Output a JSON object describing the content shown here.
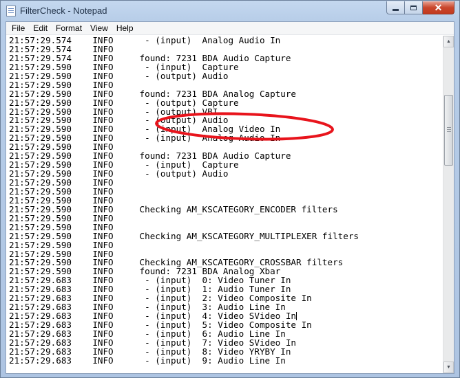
{
  "window": {
    "title": "FilterCheck - Notepad",
    "close_glyph": "✕"
  },
  "menu": [
    "File",
    "Edit",
    "Format",
    "View",
    "Help"
  ],
  "annotation": {
    "color": "#e8141c",
    "shape": "ellipse"
  },
  "lines": [
    "21:57:29.574    INFO      - (input)  Analog Audio In",
    "21:57:29.574    INFO",
    "21:57:29.574    INFO     found: 7231 BDA Audio Capture",
    "21:57:29.590    INFO      - (input)  Capture",
    "21:57:29.590    INFO      - (output) Audio",
    "21:57:29.590    INFO",
    "21:57:29.590    INFO     found: 7231 BDA Analog Capture",
    "21:57:29.590    INFO      - (output) Capture",
    "21:57:29.590    INFO      - (output) VBI",
    "21:57:29.590    INFO      - (output) Audio",
    "21:57:29.590    INFO      - (input)  Analog Video In",
    "21:57:29.590    INFO      - (input)  Analog Audio In",
    "21:57:29.590    INFO",
    "21:57:29.590    INFO     found: 7231 BDA Audio Capture",
    "21:57:29.590    INFO      - (input)  Capture",
    "21:57:29.590    INFO      - (output) Audio",
    "21:57:29.590    INFO",
    "21:57:29.590    INFO",
    "21:57:29.590    INFO",
    "21:57:29.590    INFO     Checking AM_KSCATEGORY_ENCODER filters",
    "21:57:29.590    INFO",
    "21:57:29.590    INFO",
    "21:57:29.590    INFO     Checking AM_KSCATEGORY_MULTIPLEXER filters",
    "21:57:29.590    INFO",
    "21:57:29.590    INFO",
    "21:57:29.590    INFO     Checking AM_KSCATEGORY_CROSSBAR filters",
    "21:57:29.590    INFO     found: 7231 BDA Analog Xbar",
    "21:57:29.683    INFO      - (input)  0: Video Tuner In",
    "21:57:29.683    INFO      - (input)  1: Audio Tuner In",
    "21:57:29.683    INFO      - (input)  2: Video Composite In",
    "21:57:29.683    INFO      - (input)  3: Audio Line In",
    "21:57:29.683    INFO      - (input)  4: Video SVideo In",
    "21:57:29.683    INFO      - (input)  5: Video Composite In",
    "21:57:29.683    INFO      - (input)  6: Audio Line In",
    "21:57:29.683    INFO      - (input)  7: Video SVideo In",
    "21:57:29.683    INFO      - (input)  8: Video YRYBY In",
    "21:57:29.683    INFO      - (input)  9: Audio Line In"
  ],
  "cursor_line": 31
}
